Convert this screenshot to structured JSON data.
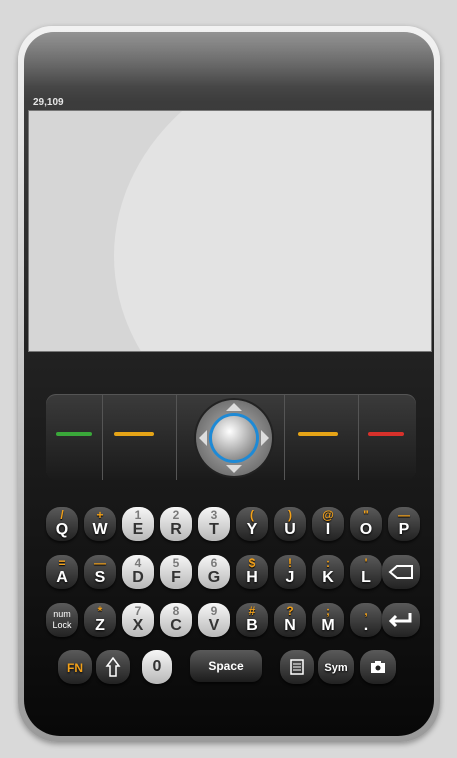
{
  "status": {
    "text": "29,109"
  },
  "keys": {
    "q": {
      "main": "Q",
      "alt": "/"
    },
    "w": {
      "main": "W",
      "alt": "+"
    },
    "e": {
      "main": "E",
      "alt": "1"
    },
    "r": {
      "main": "R",
      "alt": "2"
    },
    "t": {
      "main": "T",
      "alt": "3"
    },
    "y": {
      "main": "Y",
      "alt": "("
    },
    "u": {
      "main": "U",
      "alt": ")"
    },
    "i": {
      "main": "I",
      "alt": "@"
    },
    "o": {
      "main": "O",
      "alt": "\""
    },
    "p": {
      "main": "P",
      "alt": "—"
    },
    "a": {
      "main": "A",
      "alt": "="
    },
    "s": {
      "main": "S",
      "alt": "—"
    },
    "d": {
      "main": "D",
      "alt": "4"
    },
    "f": {
      "main": "F",
      "alt": "5"
    },
    "g": {
      "main": "G",
      "alt": "6"
    },
    "h": {
      "main": "H",
      "alt": "$"
    },
    "j": {
      "main": "J",
      "alt": "!"
    },
    "k": {
      "main": "K",
      "alt": ":"
    },
    "l": {
      "main": "L",
      "alt": "'"
    },
    "z": {
      "main": "Z",
      "alt": "*"
    },
    "x": {
      "main": "X",
      "alt": "7"
    },
    "c": {
      "main": "C",
      "alt": "8"
    },
    "v": {
      "main": "V",
      "alt": "9"
    },
    "b": {
      "main": "B",
      "alt": "#"
    },
    "n": {
      "main": "N",
      "alt": "?"
    },
    "m": {
      "main": "M",
      "alt": ";"
    },
    "period": {
      "main": ".",
      "alt": ","
    },
    "zero": {
      "main": "0"
    }
  },
  "special": {
    "numlock_line1": "num",
    "numlock_line2": "Lock",
    "fn": "FN",
    "space": "Space",
    "sym": "Sym"
  },
  "colors": {
    "call_green": "#3aa83a",
    "soft_yellow": "#e6a417",
    "end_red": "#d8312b",
    "alt_orange": "#f2a11a",
    "trackball_ring": "#1e8ad6"
  },
  "icons": [
    "call-icon",
    "menu-icon",
    "trackball-icon",
    "back-icon",
    "end-call-icon",
    "backspace-icon",
    "enter-icon",
    "shift-icon",
    "speaker-icon",
    "camera-icon"
  ]
}
